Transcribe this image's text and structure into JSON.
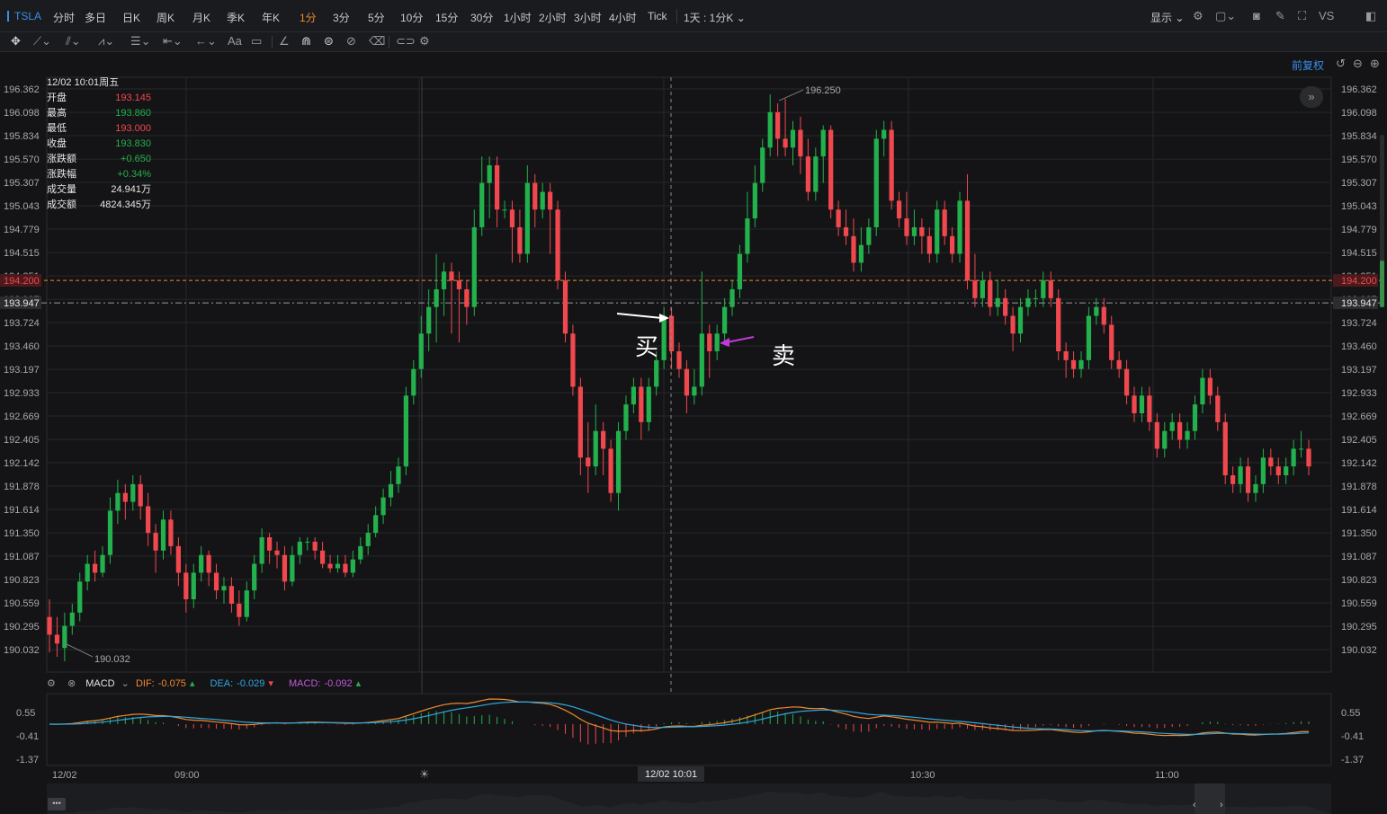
{
  "toolbar": {
    "symbol": "TSLA",
    "periods": [
      "分时",
      "多日",
      "日K",
      "周K",
      "月K",
      "季K",
      "年K",
      "1分",
      "3分",
      "5分",
      "10分",
      "15分",
      "30分",
      "1小时",
      "2小时",
      "3小时",
      "4小时",
      "Tick"
    ],
    "active_period": "1分",
    "range_label": "1天 : 1分K",
    "display_label": "显示",
    "vs_label": "VS",
    "text_tool": "Aa"
  },
  "adjust_label": "前复权",
  "info_panel": {
    "datetime": "12/02 10:01周五",
    "rows": [
      {
        "label": "开盘",
        "value": "193.145",
        "color": "#f0484e"
      },
      {
        "label": "最高",
        "value": "193.860",
        "color": "#22b14c"
      },
      {
        "label": "最低",
        "value": "193.000",
        "color": "#f0484e"
      },
      {
        "label": "收盘",
        "value": "193.830",
        "color": "#22b14c"
      },
      {
        "label": "涨跌额",
        "value": "+0.650",
        "color": "#22b14c"
      },
      {
        "label": "涨跌幅",
        "value": "+0.34%",
        "color": "#22b14c"
      },
      {
        "label": "成交量",
        "value": "24.941万",
        "color": "#e6e6e6"
      },
      {
        "label": "成交额",
        "value": "4824.345万",
        "color": "#e6e6e6"
      }
    ]
  },
  "annotations": {
    "buy": "买",
    "sell": "卖"
  },
  "colors": {
    "up": "#22b14c",
    "down": "#f0484e",
    "dif": "#f08a2e",
    "dea": "#2fa7e0",
    "bg": "#141416",
    "grid": "#26272b"
  },
  "macd": {
    "name": "MACD",
    "dif_label": "DIF:",
    "dif_value": "-0.075",
    "dea_label": "DEA:",
    "dea_value": "-0.029",
    "macd_label": "MACD:",
    "macd_value": "-0.092",
    "axis": [
      "0.55",
      "-0.41",
      "-1.37"
    ]
  },
  "chart_data": {
    "type": "candlestick",
    "symbol": "TSLA",
    "date": "12/02",
    "y_ticks": [
      "196.362",
      "196.098",
      "195.834",
      "195.570",
      "195.307",
      "195.043",
      "194.779",
      "194.515",
      "194.251",
      "193.987",
      "193.724",
      "193.460",
      "193.197",
      "192.933",
      "192.669",
      "192.405",
      "192.142",
      "191.878",
      "191.614",
      "191.350",
      "191.087",
      "190.823",
      "190.559",
      "190.295",
      "190.032"
    ],
    "ylim": [
      190.032,
      196.362
    ],
    "x_labels": [
      "12/02",
      "09:00",
      "10:30",
      "11:00"
    ],
    "crosshair_time": "12/02 10:01",
    "high_label": "196.250",
    "low_label": "190.032",
    "ref_lines": [
      {
        "value": 194.2,
        "label": "194.200",
        "color": "#f08a2e"
      },
      {
        "value": 193.947,
        "label": "193.947",
        "color": "#9a9aa0"
      }
    ],
    "candles": [
      [
        190.4,
        190.2,
        190.6,
        190.0
      ],
      [
        190.2,
        190.1,
        190.4,
        189.95
      ],
      [
        190.05,
        190.3,
        190.45,
        189.9
      ],
      [
        190.3,
        190.45,
        190.55,
        190.2
      ],
      [
        190.45,
        190.8,
        190.9,
        190.35
      ],
      [
        190.8,
        191.0,
        191.1,
        190.7
      ],
      [
        191.0,
        190.9,
        191.15,
        190.8
      ],
      [
        190.9,
        191.1,
        191.2,
        190.85
      ],
      [
        191.1,
        191.6,
        191.75,
        191.0
      ],
      [
        191.6,
        191.8,
        191.95,
        191.45
      ],
      [
        191.8,
        191.7,
        191.9,
        191.5
      ],
      [
        191.7,
        191.9,
        192.0,
        191.6
      ],
      [
        191.9,
        191.65,
        192.0,
        191.5
      ],
      [
        191.65,
        191.35,
        191.8,
        191.2
      ],
      [
        191.35,
        191.15,
        191.45,
        190.9
      ],
      [
        191.15,
        191.5,
        191.6,
        191.05
      ],
      [
        191.5,
        191.2,
        191.6,
        191.1
      ],
      [
        191.2,
        190.9,
        191.3,
        190.75
      ],
      [
        190.9,
        190.6,
        191.0,
        190.45
      ],
      [
        190.6,
        190.9,
        191.0,
        190.5
      ],
      [
        190.9,
        191.1,
        191.2,
        190.8
      ],
      [
        191.1,
        190.9,
        191.15,
        190.75
      ],
      [
        190.9,
        190.7,
        191.0,
        190.6
      ],
      [
        190.7,
        190.75,
        190.85,
        190.55
      ],
      [
        190.75,
        190.55,
        190.85,
        190.45
      ],
      [
        190.55,
        190.4,
        190.7,
        190.3
      ],
      [
        190.4,
        190.7,
        190.8,
        190.35
      ],
      [
        190.7,
        191.0,
        191.1,
        190.6
      ],
      [
        191.0,
        191.3,
        191.4,
        190.9
      ],
      [
        191.3,
        191.15,
        191.35,
        191.0
      ],
      [
        191.15,
        191.1,
        191.25,
        190.95
      ],
      [
        191.1,
        190.8,
        191.2,
        190.7
      ],
      [
        190.8,
        191.1,
        191.2,
        190.75
      ],
      [
        191.1,
        191.25,
        191.3,
        191.0
      ],
      [
        191.25,
        191.25,
        191.3,
        191.15
      ],
      [
        191.25,
        191.15,
        191.3,
        191.05
      ],
      [
        191.15,
        191.0,
        191.25,
        190.95
      ],
      [
        191.0,
        190.95,
        191.1,
        190.9
      ],
      [
        190.95,
        191.0,
        191.1,
        190.9
      ],
      [
        191.0,
        190.9,
        191.1,
        190.85
      ],
      [
        190.9,
        191.05,
        191.15,
        190.85
      ],
      [
        191.05,
        191.2,
        191.3,
        191.0
      ],
      [
        191.2,
        191.35,
        191.45,
        191.1
      ],
      [
        191.35,
        191.55,
        191.65,
        191.3
      ],
      [
        191.55,
        191.75,
        191.85,
        191.45
      ],
      [
        191.75,
        191.9,
        192.05,
        191.65
      ],
      [
        191.9,
        192.1,
        192.2,
        191.8
      ],
      [
        192.1,
        192.9,
        193.0,
        192.0
      ],
      [
        192.9,
        193.2,
        193.3,
        192.8
      ],
      [
        193.2,
        193.6,
        193.8,
        193.1
      ],
      [
        193.6,
        193.9,
        194.1,
        193.4
      ],
      [
        193.9,
        194.1,
        194.5,
        193.5
      ],
      [
        194.1,
        194.3,
        194.4,
        193.8
      ],
      [
        194.3,
        194.2,
        194.4,
        193.6
      ],
      [
        194.2,
        194.1,
        194.3,
        193.5
      ],
      [
        194.1,
        193.9,
        194.2,
        193.7
      ],
      [
        193.9,
        194.8,
        195.0,
        193.8
      ],
      [
        194.8,
        195.3,
        195.6,
        194.7
      ],
      [
        195.3,
        195.5,
        195.6,
        194.9
      ],
      [
        195.5,
        195.0,
        195.6,
        194.8
      ],
      [
        195.0,
        195.0,
        195.1,
        194.9
      ],
      [
        195.0,
        194.8,
        195.1,
        194.4
      ],
      [
        194.8,
        194.5,
        195.0,
        194.4
      ],
      [
        194.5,
        195.3,
        195.5,
        194.4
      ],
      [
        195.3,
        195.0,
        195.4,
        194.8
      ],
      [
        195.0,
        195.2,
        195.3,
        194.9
      ],
      [
        195.2,
        195.0,
        195.3,
        194.5
      ],
      [
        195.0,
        194.2,
        195.1,
        194.1
      ],
      [
        194.2,
        193.6,
        194.3,
        193.5
      ],
      [
        193.6,
        193.0,
        193.7,
        192.9
      ],
      [
        193.0,
        192.2,
        193.1,
        192.0
      ],
      [
        192.2,
        192.1,
        192.6,
        191.8
      ],
      [
        192.1,
        192.5,
        192.8,
        192.0
      ],
      [
        192.5,
        192.3,
        192.6,
        192.0
      ],
      [
        192.3,
        191.8,
        192.4,
        191.7
      ],
      [
        191.8,
        192.5,
        192.6,
        191.6
      ],
      [
        192.5,
        192.8,
        192.9,
        192.4
      ],
      [
        192.8,
        193.0,
        193.1,
        192.7
      ],
      [
        193.0,
        192.6,
        193.1,
        192.4
      ],
      [
        192.6,
        193.0,
        193.1,
        192.5
      ],
      [
        193.0,
        193.3,
        193.4,
        192.9
      ],
      [
        193.3,
        193.8,
        193.9,
        193.2
      ],
      [
        193.8,
        193.4,
        193.9,
        193.2
      ],
      [
        193.4,
        193.2,
        193.5,
        193.1
      ],
      [
        193.2,
        192.9,
        193.3,
        192.7
      ],
      [
        192.9,
        193.0,
        193.2,
        192.8
      ],
      [
        193.0,
        193.6,
        194.3,
        192.9
      ],
      [
        193.6,
        193.4,
        193.7,
        193.1
      ],
      [
        193.4,
        193.6,
        193.7,
        193.3
      ],
      [
        193.6,
        193.9,
        194.0,
        193.5
      ],
      [
        193.9,
        194.1,
        194.2,
        193.8
      ],
      [
        194.1,
        194.5,
        194.6,
        194.0
      ],
      [
        194.5,
        194.9,
        195.2,
        194.4
      ],
      [
        194.9,
        195.3,
        195.5,
        194.8
      ],
      [
        195.3,
        195.7,
        195.8,
        195.2
      ],
      [
        195.7,
        196.1,
        196.3,
        195.6
      ],
      [
        196.1,
        195.8,
        196.2,
        195.6
      ],
      [
        195.8,
        195.7,
        196.25,
        195.6
      ],
      [
        195.7,
        195.9,
        196.0,
        195.5
      ],
      [
        195.9,
        195.6,
        196.05,
        195.4
      ],
      [
        195.6,
        195.2,
        195.8,
        195.1
      ],
      [
        195.2,
        195.6,
        195.7,
        195.1
      ],
      [
        195.6,
        195.9,
        195.95,
        195.3
      ],
      [
        195.9,
        195.0,
        195.95,
        194.9
      ],
      [
        195.0,
        194.8,
        195.1,
        194.7
      ],
      [
        194.8,
        194.7,
        195.0,
        194.6
      ],
      [
        194.7,
        194.4,
        194.9,
        194.3
      ],
      [
        194.4,
        194.6,
        194.8,
        194.3
      ],
      [
        194.6,
        194.8,
        194.9,
        194.5
      ],
      [
        194.8,
        195.8,
        195.9,
        194.7
      ],
      [
        195.8,
        195.9,
        196.0,
        195.6
      ],
      [
        195.9,
        195.1,
        196.0,
        195.0
      ],
      [
        195.1,
        194.9,
        195.2,
        194.8
      ],
      [
        194.9,
        194.7,
        195.2,
        194.6
      ],
      [
        194.7,
        194.8,
        195.0,
        194.6
      ],
      [
        194.8,
        194.7,
        194.9,
        194.5
      ],
      [
        194.7,
        194.5,
        194.8,
        194.4
      ],
      [
        194.5,
        195.0,
        195.1,
        194.4
      ],
      [
        195.0,
        194.7,
        195.1,
        194.6
      ],
      [
        194.7,
        194.5,
        194.8,
        194.4
      ],
      [
        194.5,
        195.1,
        195.2,
        194.4
      ],
      [
        195.1,
        194.2,
        195.4,
        194.1
      ],
      [
        194.2,
        194.0,
        194.5,
        193.9
      ],
      [
        194.0,
        194.2,
        194.3,
        193.9
      ],
      [
        194.2,
        193.9,
        194.3,
        193.8
      ],
      [
        193.9,
        194.0,
        194.2,
        193.8
      ],
      [
        194.0,
        193.8,
        194.1,
        193.7
      ],
      [
        193.8,
        193.6,
        193.9,
        193.4
      ],
      [
        193.6,
        193.9,
        194.0,
        193.5
      ],
      [
        193.9,
        194.0,
        194.1,
        193.8
      ],
      [
        194.0,
        194.0,
        194.1,
        193.9
      ],
      [
        194.0,
        194.2,
        194.3,
        193.9
      ],
      [
        194.2,
        194.0,
        194.3,
        193.9
      ],
      [
        194.0,
        193.4,
        194.1,
        193.3
      ],
      [
        193.4,
        193.3,
        193.5,
        193.1
      ],
      [
        193.3,
        193.2,
        193.4,
        193.1
      ],
      [
        193.2,
        193.3,
        193.4,
        193.1
      ],
      [
        193.3,
        193.8,
        193.9,
        193.2
      ],
      [
        193.8,
        193.9,
        194.0,
        193.7
      ],
      [
        193.9,
        193.7,
        194.0,
        193.6
      ],
      [
        193.7,
        193.3,
        193.8,
        193.2
      ],
      [
        193.3,
        193.2,
        193.4,
        193.1
      ],
      [
        193.2,
        192.9,
        193.3,
        192.8
      ],
      [
        192.9,
        192.7,
        193.0,
        192.6
      ],
      [
        192.7,
        192.9,
        193.0,
        192.6
      ],
      [
        192.9,
        192.6,
        193.0,
        192.5
      ],
      [
        192.6,
        192.3,
        192.7,
        192.2
      ],
      [
        192.3,
        192.5,
        192.6,
        192.2
      ],
      [
        192.5,
        192.6,
        192.7,
        192.4
      ],
      [
        192.6,
        192.4,
        192.7,
        192.3
      ],
      [
        192.4,
        192.5,
        192.6,
        192.3
      ],
      [
        192.5,
        192.8,
        192.9,
        192.4
      ],
      [
        192.8,
        193.1,
        193.2,
        192.7
      ],
      [
        193.1,
        192.9,
        193.2,
        192.8
      ],
      [
        192.9,
        192.6,
        193.0,
        192.5
      ],
      [
        192.6,
        192.0,
        192.7,
        191.9
      ],
      [
        192.0,
        191.9,
        192.1,
        191.8
      ],
      [
        191.9,
        192.1,
        192.2,
        191.8
      ],
      [
        192.1,
        191.8,
        192.2,
        191.7
      ],
      [
        191.8,
        191.9,
        192.0,
        191.7
      ],
      [
        191.9,
        192.2,
        192.3,
        191.8
      ],
      [
        192.2,
        192.1,
        192.3,
        192.0
      ],
      [
        192.1,
        192.0,
        192.2,
        191.9
      ],
      [
        192.0,
        192.1,
        192.2,
        191.9
      ],
      [
        192.1,
        192.3,
        192.4,
        192.0
      ],
      [
        192.3,
        192.3,
        192.5,
        192.2
      ],
      [
        192.3,
        192.1,
        192.4,
        192.0
      ]
    ]
  }
}
